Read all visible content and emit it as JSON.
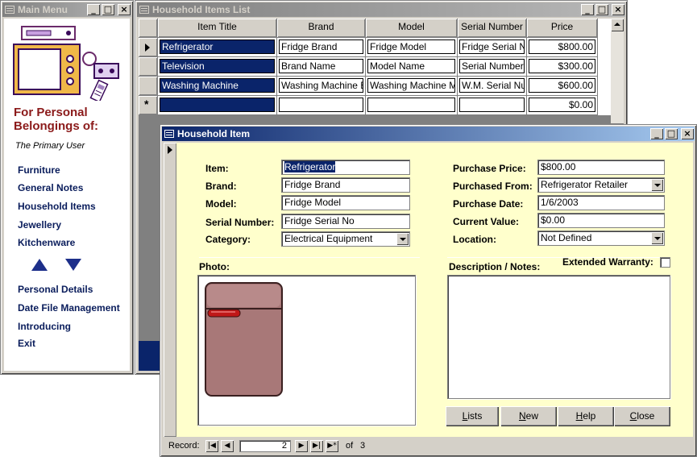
{
  "main_menu": {
    "window_title": "Main Menu",
    "heading": "For Personal Belongings of:",
    "owner": "The Primary User",
    "links": [
      "Furniture",
      "General Notes",
      "Household Items",
      "Jewellery",
      "Kitchenware"
    ],
    "links2": [
      "Personal Details",
      "Date File Management",
      "Introducing",
      "Exit"
    ]
  },
  "list_window": {
    "window_title": "Household Items List",
    "columns": [
      "Item Title",
      "Brand",
      "Model",
      "Serial Number",
      "Price"
    ],
    "rows": [
      [
        "Refrigerator",
        "Fridge Brand",
        "Fridge Model",
        "Fridge Serial No",
        "$800.00"
      ],
      [
        "Television",
        "Brand Name",
        "Model Name",
        "Serial Number",
        "$300.00"
      ],
      [
        "Washing Machine",
        "Washing Machine Bra",
        "Washing Machine Mod",
        "W.M. Serial Numl",
        "$600.00"
      ]
    ],
    "new_row_price": "$0.00"
  },
  "item_form": {
    "window_title": "Household Item",
    "labels": {
      "item": "Item:",
      "brand": "Brand:",
      "model": "Model:",
      "serial": "Serial Number:",
      "category": "Category:",
      "price": "Purchase Price:",
      "from": "Purchased From:",
      "date": "Purchase Date:",
      "value": "Current Value:",
      "location": "Location:",
      "photo": "Photo:",
      "notes": "Description / Notes:",
      "warranty": "Extended Warranty:"
    },
    "values": {
      "item": "Refrigerator",
      "brand": "Fridge Brand",
      "model": "Fridge Model",
      "serial": "Fridge Serial No",
      "category": "Electrical Equipment",
      "price": "$800.00",
      "from": "Refrigerator Retailer",
      "date": "1/6/2003",
      "value": "$0.00",
      "location": "Not Defined"
    },
    "buttons": {
      "lists_u": "L",
      "lists_rest": "ists",
      "new_u": "N",
      "new_rest": "ew",
      "help_u": "H",
      "help_rest": "elp",
      "close_u": "C",
      "close_rest": "lose"
    },
    "nav": {
      "record_label": "Record:",
      "current": "2",
      "of_label": "of",
      "total": "3"
    }
  },
  "icons": [
    "window-icon",
    "minimize-icon",
    "maximize-icon",
    "close-icon",
    "up-arrow-icon",
    "down-arrow-icon",
    "record-pointer-icon",
    "new-record-icon",
    "first-record-icon",
    "prev-record-icon",
    "next-record-icon",
    "last-record-icon",
    "new-record-nav-icon",
    "dropdown-arrow-icon",
    "scroll-up-icon"
  ],
  "colors": {
    "active_title": "#0a246a",
    "form_bg": "#ffffcc",
    "menu_heading": "#8b1a1a",
    "menu_link": "#0a1d5c",
    "selected_cell": "#0a246a"
  }
}
